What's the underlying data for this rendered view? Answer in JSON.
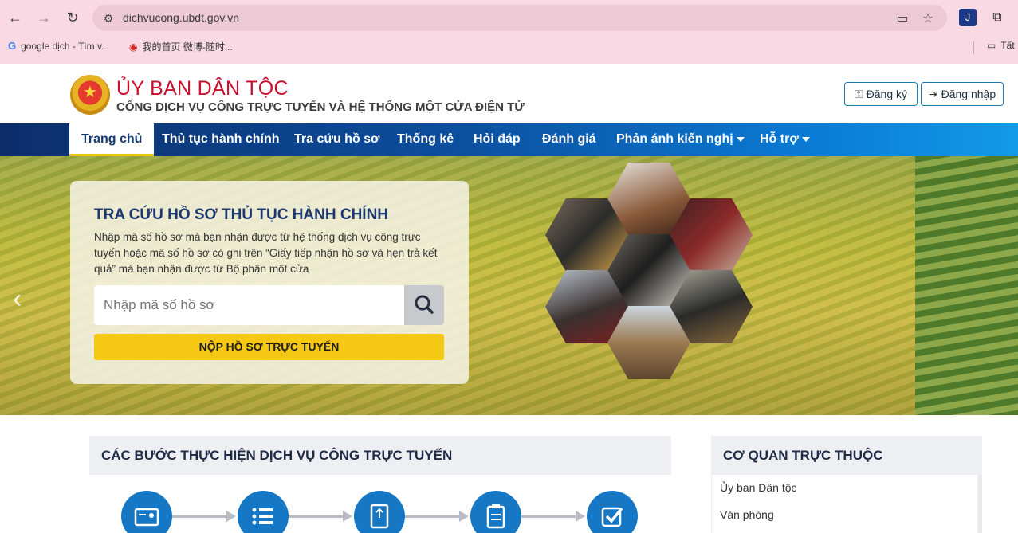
{
  "browser": {
    "url": "dichvucong.ubdt.gov.vn",
    "bookmarks": [
      "google dịch - Tìm v...",
      "我的首页 微博-随时..."
    ],
    "bookmark_folder": "Tất"
  },
  "header": {
    "title": "ỦY BAN DÂN TỘC",
    "subtitle": "CỔNG DỊCH VỤ CÔNG TRỰC TUYẾN VÀ HỆ THỐNG MỘT CỬA ĐIỆN TỬ",
    "register_label": "Đăng ký",
    "login_label": "Đăng nhập"
  },
  "nav": {
    "items": [
      {
        "label": "Trang chủ"
      },
      {
        "label": "Thủ tục hành chính"
      },
      {
        "label": "Tra cứu hồ sơ"
      },
      {
        "label": "Thống kê"
      },
      {
        "label": "Hỏi đáp"
      },
      {
        "label": "Đánh giá"
      },
      {
        "label": "Phản ánh kiến nghị"
      },
      {
        "label": "Hỗ trợ"
      }
    ]
  },
  "hero": {
    "title": "TRA CỨU HỒ SƠ THỦ TỤC HÀNH CHÍNH",
    "description": "Nhập mã số hồ sơ mà bạn nhận được từ hệ thống dịch vụ công trực tuyến hoặc mã số hồ sơ có ghi trên “Giấy tiếp nhận hồ sơ và hẹn trả kết quả” mà bạn nhận được từ Bộ phận một cửa",
    "search_placeholder": "Nhập mã số hồ sơ",
    "submit_label": "NỘP HỒ SƠ TRỰC TUYẾN"
  },
  "steps": {
    "title": "CÁC BƯỚC THỰC HIỆN DỊCH VỤ CÔNG TRỰC TUYẾN",
    "icons": [
      "id-card-icon",
      "list-icon",
      "upload-document-icon",
      "clipboard-icon",
      "checkmark-icon"
    ]
  },
  "agencies": {
    "title": "CƠ QUAN TRỰC THUỘC",
    "items": [
      "Ủy ban Dân tộc",
      "Văn phòng"
    ]
  },
  "colors": {
    "brand_red": "#c8102e",
    "navy": "#1d3870",
    "accent_yellow": "#f5c814",
    "nav_blue": "#0c4f9e"
  }
}
